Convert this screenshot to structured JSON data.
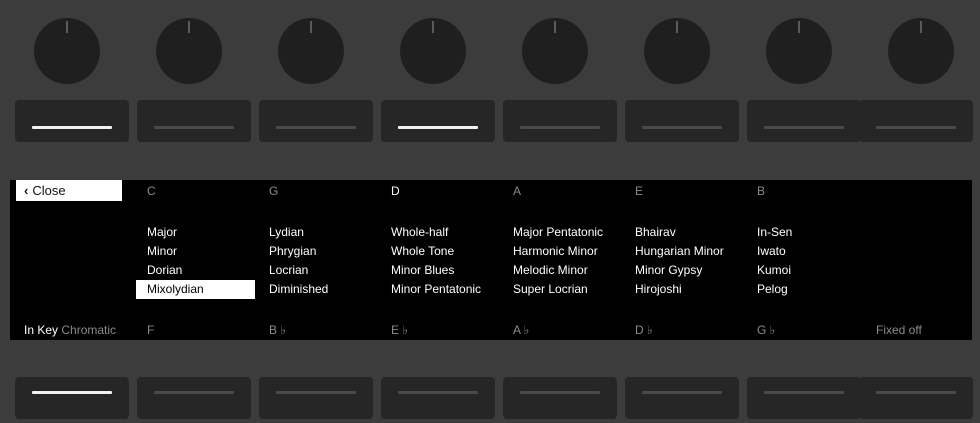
{
  "knobs": [
    {
      "name": "knob-1"
    },
    {
      "name": "knob-2"
    },
    {
      "name": "knob-3"
    },
    {
      "name": "knob-4"
    },
    {
      "name": "knob-5"
    },
    {
      "name": "knob-6"
    },
    {
      "name": "knob-7"
    },
    {
      "name": "knob-8"
    }
  ],
  "top_buttons_active": [
    true,
    false,
    false,
    true,
    false,
    false,
    false,
    false
  ],
  "bottom_buttons_active": [
    true,
    false,
    false,
    false,
    false,
    false,
    false,
    false
  ],
  "display": {
    "close_label": "Close",
    "close_icon": "chevron-left-icon",
    "roots_top": [
      "C",
      "G",
      "D",
      "A",
      "E",
      "B"
    ],
    "selected_root": "D",
    "roots_bottom": [
      "F",
      "B ♭",
      "E ♭",
      "A ♭",
      "D ♭",
      "G ♭"
    ],
    "in_key_label": "In Key",
    "chromatic_label": "Chromatic",
    "fixed_label": "Fixed off",
    "scale_columns": [
      [
        "Major",
        "Minor",
        "Dorian",
        "Mixolydian"
      ],
      [
        "Lydian",
        "Phrygian",
        "Locrian",
        "Diminished"
      ],
      [
        "Whole-half",
        "Whole Tone",
        "Minor Blues",
        "Minor Pentatonic"
      ],
      [
        "Major Pentatonic",
        "Harmonic Minor",
        "Melodic Minor",
        "Super Locrian"
      ],
      [
        "Bhairav",
        "Hungarian Minor",
        "Minor Gypsy",
        "Hirojoshi"
      ],
      [
        "In-Sen",
        "Iwato",
        "Kumoi",
        "Pelog"
      ]
    ],
    "selected_scale": "Mixolydian"
  }
}
